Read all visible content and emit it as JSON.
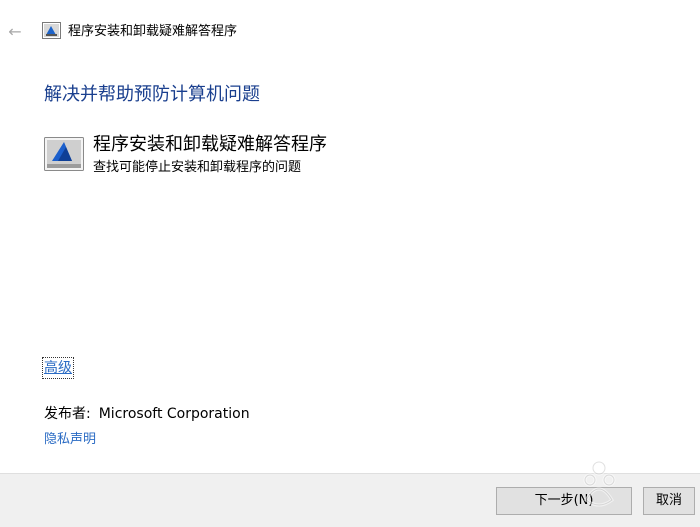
{
  "window": {
    "title": "程序安装和卸载疑难解答程序",
    "back_icon": "back-arrow-icon",
    "app_icon": "troubleshooter-icon"
  },
  "main": {
    "heading": "解决并帮助预防计算机问题",
    "tool": {
      "icon": "program-install-uninstall-icon",
      "title": "程序安装和卸载疑难解答程序",
      "description": "查找可能停止安装和卸载程序的问题"
    },
    "advanced_link": "高级",
    "publisher": {
      "label": "发布者:",
      "value": "Microsoft Corporation"
    },
    "privacy_link": "隐私声明"
  },
  "footer": {
    "next_button": "下一步(N)",
    "cancel_button": "取消"
  },
  "colors": {
    "heading": "#1a3f8e",
    "link": "#2a6bc4",
    "footer_bg": "#f0f0f0"
  }
}
